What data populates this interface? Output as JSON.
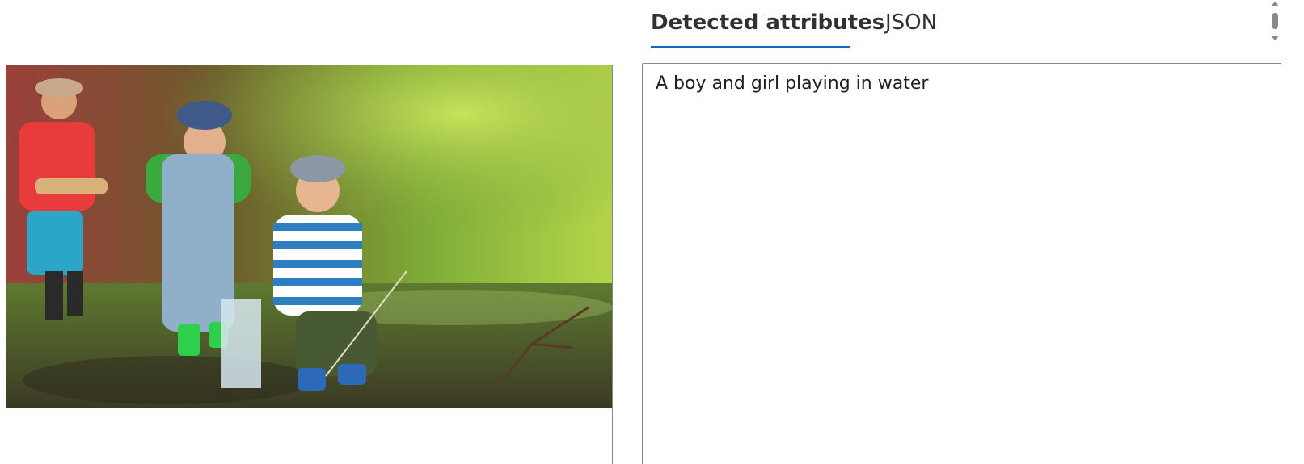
{
  "tabs": {
    "detected_label": "Detected attributes",
    "json_label": "JSON"
  },
  "results": {
    "caption": "A boy and girl playing in water"
  },
  "colors": {
    "accent": "#0f6cbd",
    "border": "#8a8886"
  },
  "icons": {
    "scroll_up": "caret-up-icon",
    "scroll_thumb": "scrollbar-thumb",
    "scroll_down": "caret-down-icon"
  }
}
